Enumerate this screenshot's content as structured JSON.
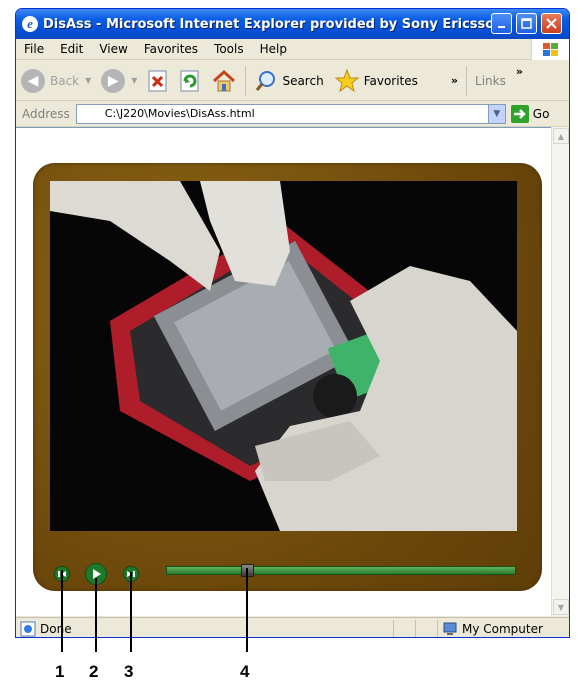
{
  "window": {
    "title": "DisAss - Microsoft Internet Explorer provided by Sony Ericsson"
  },
  "menu": [
    "File",
    "Edit",
    "View",
    "Favorites",
    "Tools",
    "Help"
  ],
  "toolbar": {
    "back": "Back",
    "search": "Search",
    "favorites": "Favorites",
    "links": "Links",
    "chevron": "»"
  },
  "address": {
    "label": "Address",
    "value": "C:\\J220\\Movies\\DisAss.html",
    "go": "Go"
  },
  "status": {
    "text": "Done",
    "zone": "My Computer"
  },
  "player": {
    "progress": 0.23
  },
  "callouts": [
    "1",
    "2",
    "3",
    "4"
  ],
  "colors": {
    "frame": "#7a550f",
    "controls": "#1d7a2c",
    "track": "#4aa84c"
  }
}
